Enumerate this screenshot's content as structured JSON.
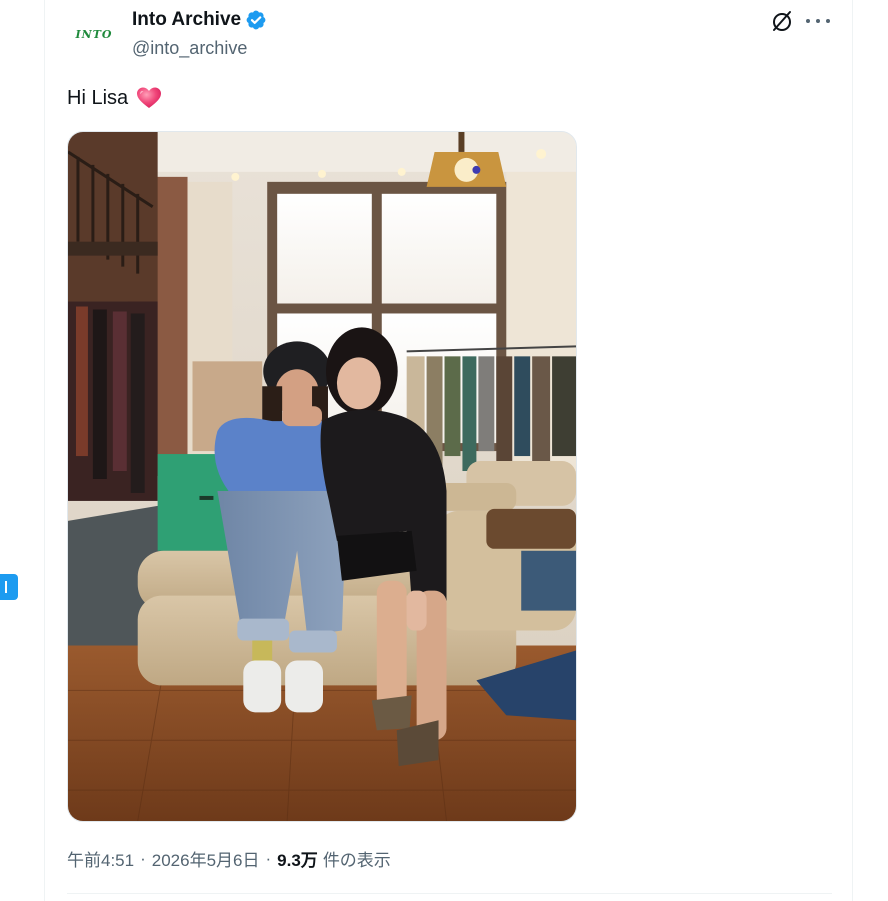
{
  "author": {
    "avatar_text": "INTO",
    "display_name": "Into Archive",
    "handle": "@into_archive",
    "verified": true
  },
  "header_actions": {
    "grok_icon": "grok-icon",
    "more_icon": "more-icon"
  },
  "tweet": {
    "text": "Hi Lisa",
    "emoji": "heart-icon"
  },
  "meta": {
    "time": "午前4:51",
    "separator": "·",
    "date": "2026年5月6日",
    "views_count": "9.3万",
    "views_label": "件の表示"
  },
  "colors": {
    "accent": "#1d9bf0",
    "text_primary": "#0f1419",
    "text_secondary": "#536471",
    "logo_green": "#1f8a3c",
    "heart": "#f0477a"
  }
}
